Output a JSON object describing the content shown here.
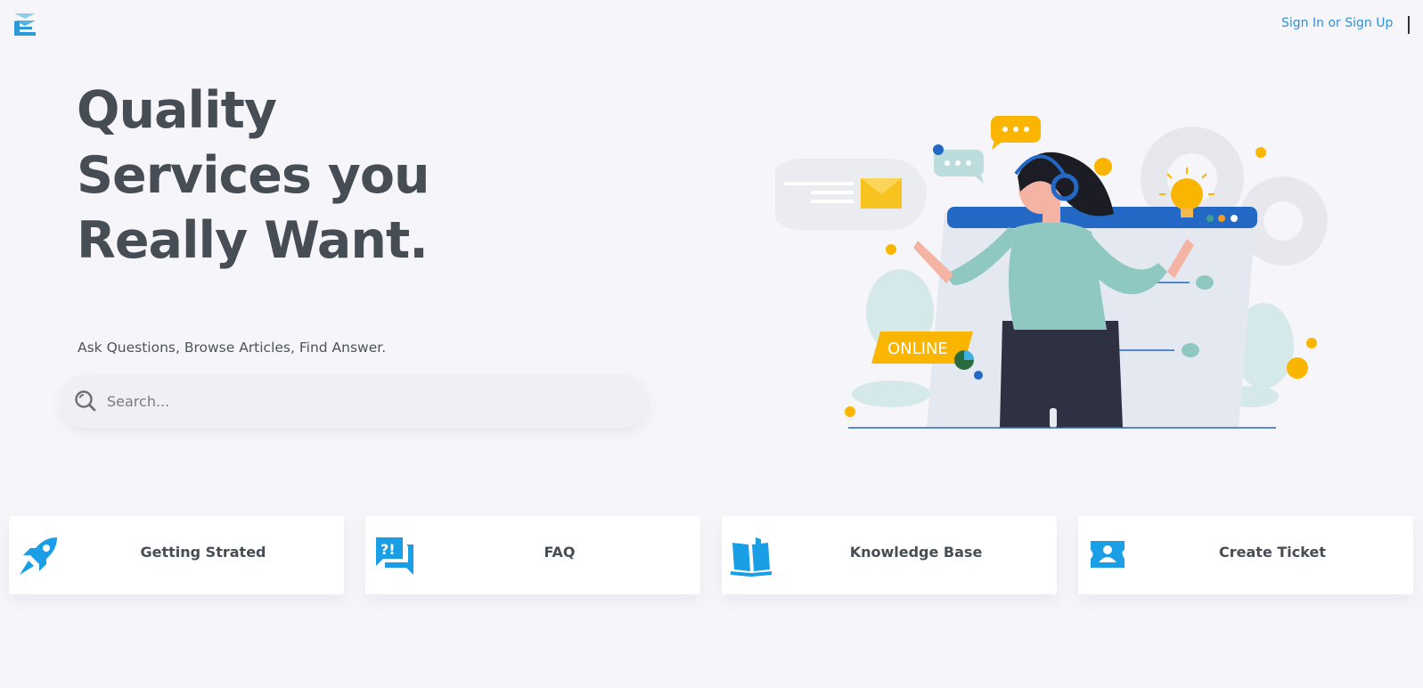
{
  "header": {
    "auth_link": "Sign In or Sign Up"
  },
  "hero": {
    "title_lines": [
      "Quality",
      "Services you",
      "Really Want."
    ],
    "subtitle": "Ask Questions, Browse Articles, Find Answer.",
    "search_placeholder": "Search..."
  },
  "illustration": {
    "badge_text": "ONLINE"
  },
  "cards": [
    {
      "label": "Getting Strated",
      "icon": "rocket-icon"
    },
    {
      "label": "FAQ",
      "icon": "faq-chat-icon"
    },
    {
      "label": "Knowledge Base",
      "icon": "open-book-icon"
    },
    {
      "label": "Create Ticket",
      "icon": "ticket-icon"
    }
  ],
  "colors": {
    "accent_blue": "#1a9ee6",
    "link_blue": "#2f93d6",
    "title_gray": "#474d55",
    "background": "#f6f6fa",
    "illustration_yellow": "#f9b500",
    "illustration_teal": "#8fc7c1"
  }
}
